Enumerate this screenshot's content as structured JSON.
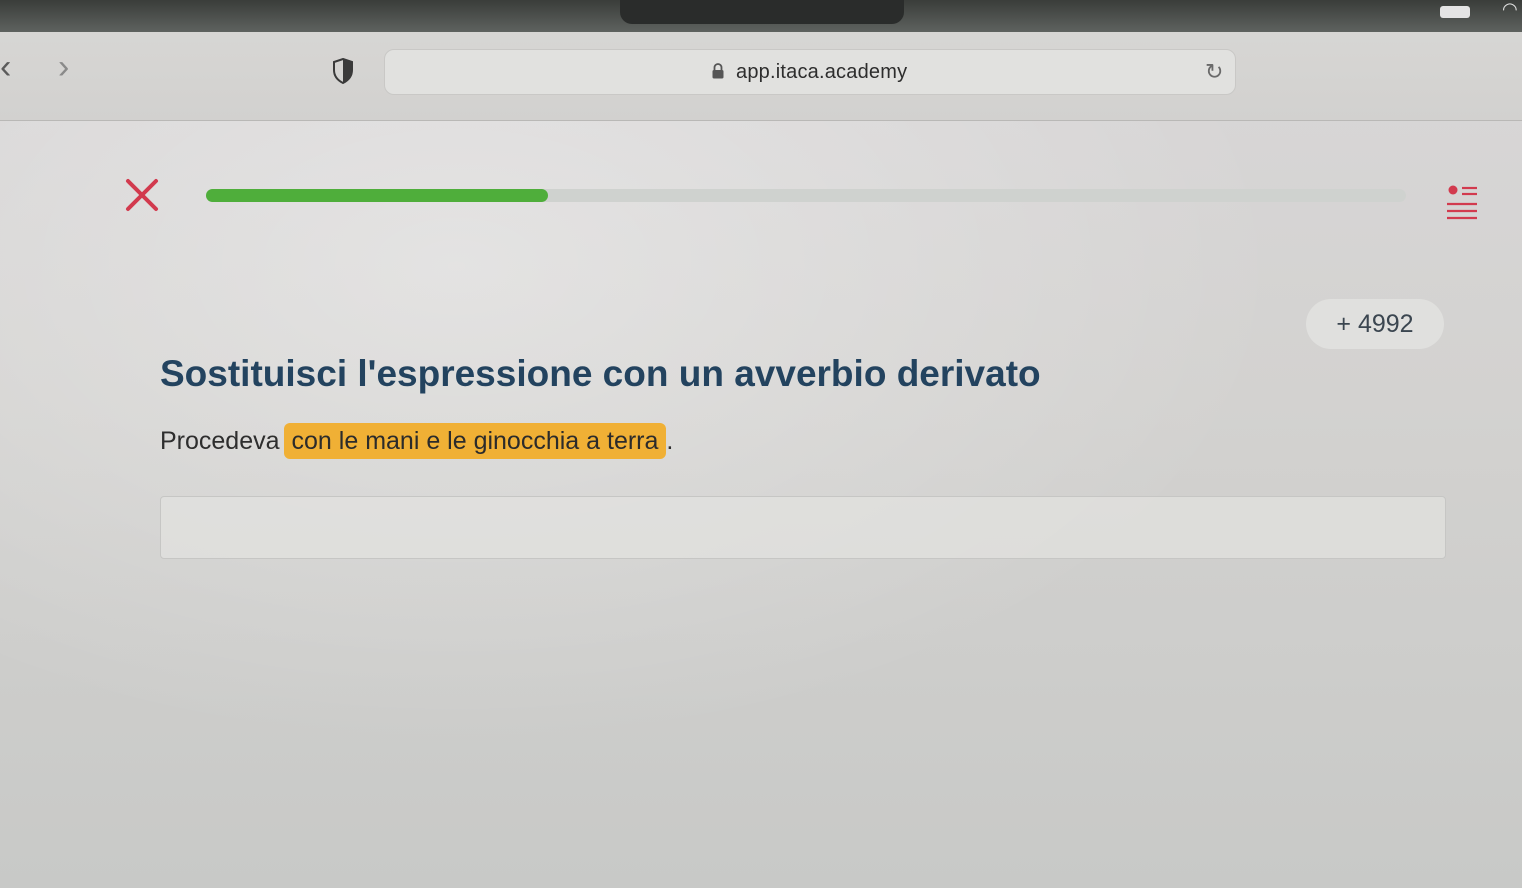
{
  "browser": {
    "url": "app.itaca.academy",
    "back_glyph": "‹",
    "forward_glyph": "›",
    "reload_glyph": "↻",
    "icons": [
      "chevron-left-icon",
      "chevron-right-icon",
      "shield-icon",
      "lock-icon",
      "reload-icon"
    ]
  },
  "exercise": {
    "progress_fraction": 0.285,
    "progress_color": "#4fae3b",
    "close_color": "#d23a4e",
    "list_icon_color": "#d23a4e",
    "score": "+ 4992",
    "title": "Sostituisci l'espressione con un avverbio derivato",
    "sentence_prefix": "Procedeva",
    "highlighted_phrase": "con le mani e le ginocchia a terra",
    "sentence_suffix": ".",
    "highlight_color": "#f0b035",
    "answer_value": "",
    "title_color": "#23435f"
  }
}
